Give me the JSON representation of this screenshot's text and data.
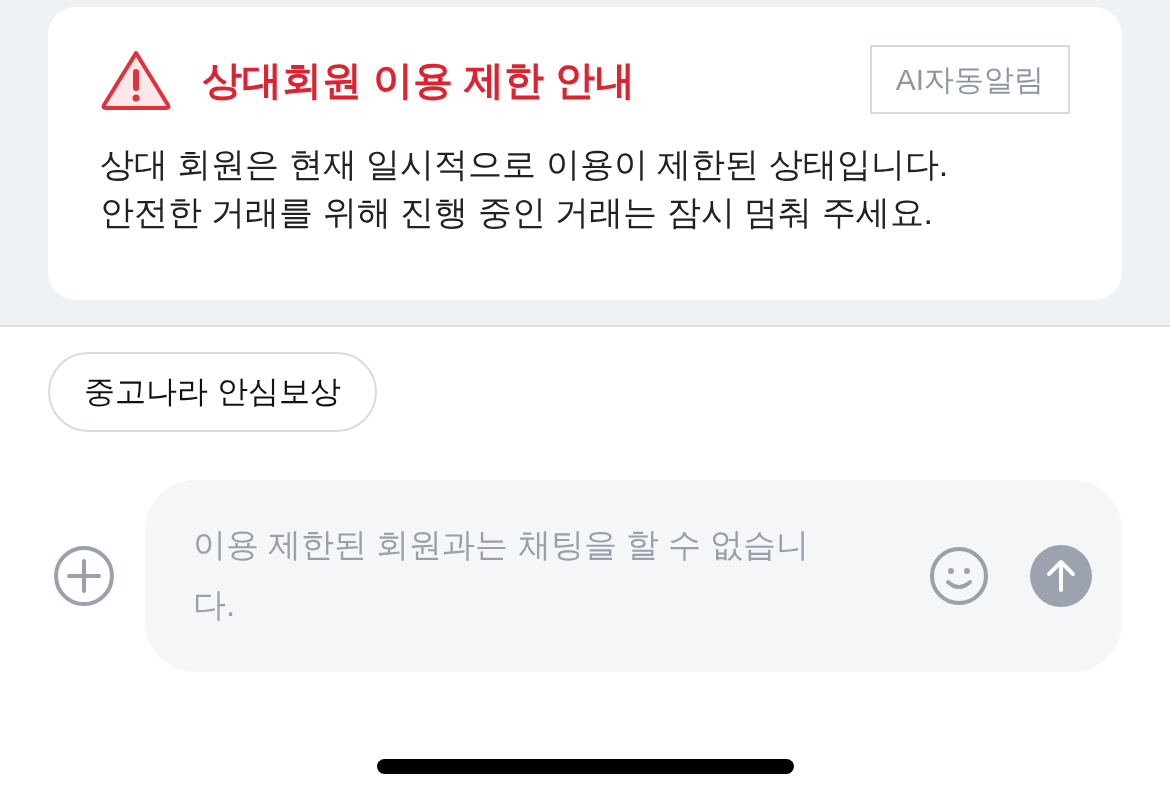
{
  "notice": {
    "title": "상대회원 이용 제한 안내",
    "badge": "AI자동알림",
    "body": "상대 회원은 현재 일시적으로 이용이 제한된 상태입니다.\n안전한 거래를 위해 진행 중인 거래는 잠시 멈춰 주세요."
  },
  "chips": [
    {
      "label": "중고나라 안심보상"
    }
  ],
  "composer": {
    "placeholder": "이용 제한된 회원과는 채팅을 할 수 없습니다.",
    "disabled": true
  }
}
